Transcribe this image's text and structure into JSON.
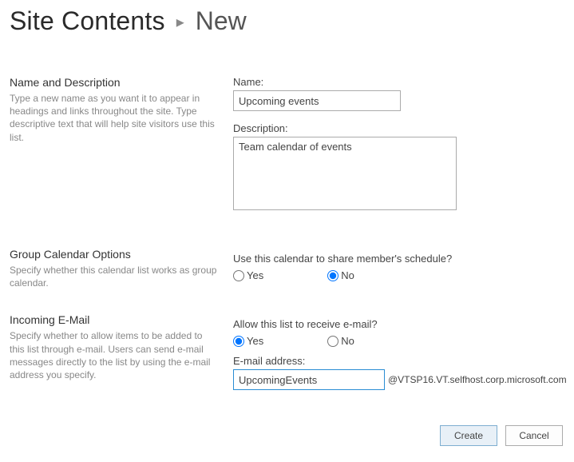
{
  "breadcrumb": {
    "root": "Site Contents",
    "separator": "▸",
    "current": "New"
  },
  "sections": {
    "nameDesc": {
      "title": "Name and Description",
      "desc": "Type a new name as you want it to appear in headings and links throughout the site. Type descriptive text that will help site visitors use this list.",
      "nameLabel": "Name:",
      "nameValue": "Upcoming events",
      "descriptionLabel": "Description:",
      "descriptionValue": "Team calendar of events"
    },
    "groupCal": {
      "title": "Group Calendar Options",
      "desc": "Specify whether this calendar list works as group calendar.",
      "question": "Use this calendar to share member's schedule?",
      "yes": "Yes",
      "no": "No",
      "selected": "no"
    },
    "incomingEmail": {
      "title": "Incoming E-Mail",
      "desc": "Specify whether to allow items to be added to this list through e-mail. Users can send e-mail messages directly to the list by using the e-mail address you specify.",
      "question": "Allow this list to receive e-mail?",
      "yes": "Yes",
      "no": "No",
      "selected": "yes",
      "emailLabel": "E-mail address:",
      "emailValue": "UpcomingEvents",
      "emailSuffix": "@VTSP16.VT.selfhost.corp.microsoft.com"
    }
  },
  "buttons": {
    "create": "Create",
    "cancel": "Cancel"
  }
}
